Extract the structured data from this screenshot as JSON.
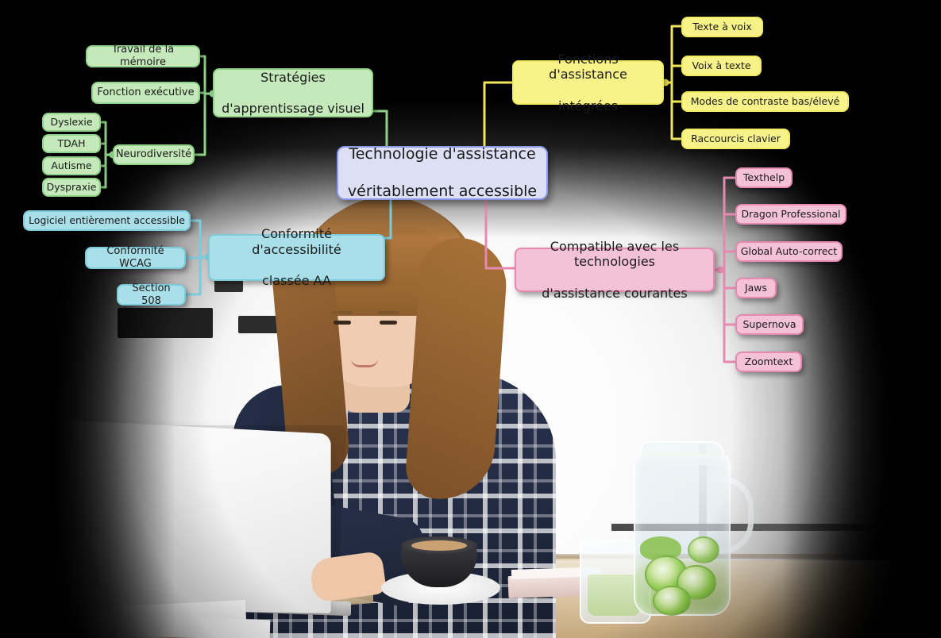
{
  "diagram": {
    "kind": "mind-map",
    "language": "fr",
    "center": {
      "label": "Technologie d'assistance véritablement accessible",
      "line1": "Technologie d'assistance",
      "line2": "véritablement accessible",
      "fill": "#dde0f5",
      "border": "#8c9ae2"
    },
    "branches": [
      {
        "id": "green",
        "color": "#c5e9bb",
        "border": "#8ed187",
        "label": "Stratégies d'apprentissage visuel",
        "line1": "Stratégies",
        "line2": "d'apprentissage visuel",
        "children": [
          {
            "label": "Travail de la mémoire"
          },
          {
            "label": "Fonction exécutive"
          },
          {
            "label": "Neurodiversité",
            "children": [
              {
                "label": "Dyslexie"
              },
              {
                "label": "TDAH"
              },
              {
                "label": "Autisme"
              },
              {
                "label": "Dyspraxie"
              }
            ]
          }
        ]
      },
      {
        "id": "yellow",
        "color": "#f7f389",
        "border": "#f2ea63",
        "label": "Fonctions d'assistance intégrées",
        "line1": "Fonctions d'assistance",
        "line2": "intégrées",
        "children": [
          {
            "label": "Texte à voix"
          },
          {
            "label": "Voix à texte"
          },
          {
            "label": "Modes de contraste bas/élevé"
          },
          {
            "label": "Raccourcis clavier"
          }
        ]
      },
      {
        "id": "pink",
        "color": "#f4c2d6",
        "border": "#e589b0",
        "label": "Compatible avec les technologies d'assistance courantes",
        "line1": "Compatible avec les technologies",
        "line2": "d'assistance courantes",
        "children": [
          {
            "label": "Texthelp"
          },
          {
            "label": "Dragon Professional"
          },
          {
            "label": "Global Auto-correct"
          },
          {
            "label": "Jaws"
          },
          {
            "label": "Supernova"
          },
          {
            "label": "Zoomtext"
          }
        ]
      },
      {
        "id": "cyan",
        "color": "#a9dfe9",
        "border": "#7ccbdb",
        "label": "Conformité d'accessibilité classée AA",
        "line1": "Conformité d'accessibilité",
        "line2": "classée AA",
        "children": [
          {
            "label": "Logiciel entièrement accessible"
          },
          {
            "label": "Conformité WCAG"
          },
          {
            "label": "Section 508"
          }
        ]
      }
    ]
  },
  "background": {
    "description": "Photo d'une femme souriante travaillant sur un ordinateur portable à une table en bois, avec une tasse de café, un pichet d'eau au concombre et un verre."
  }
}
